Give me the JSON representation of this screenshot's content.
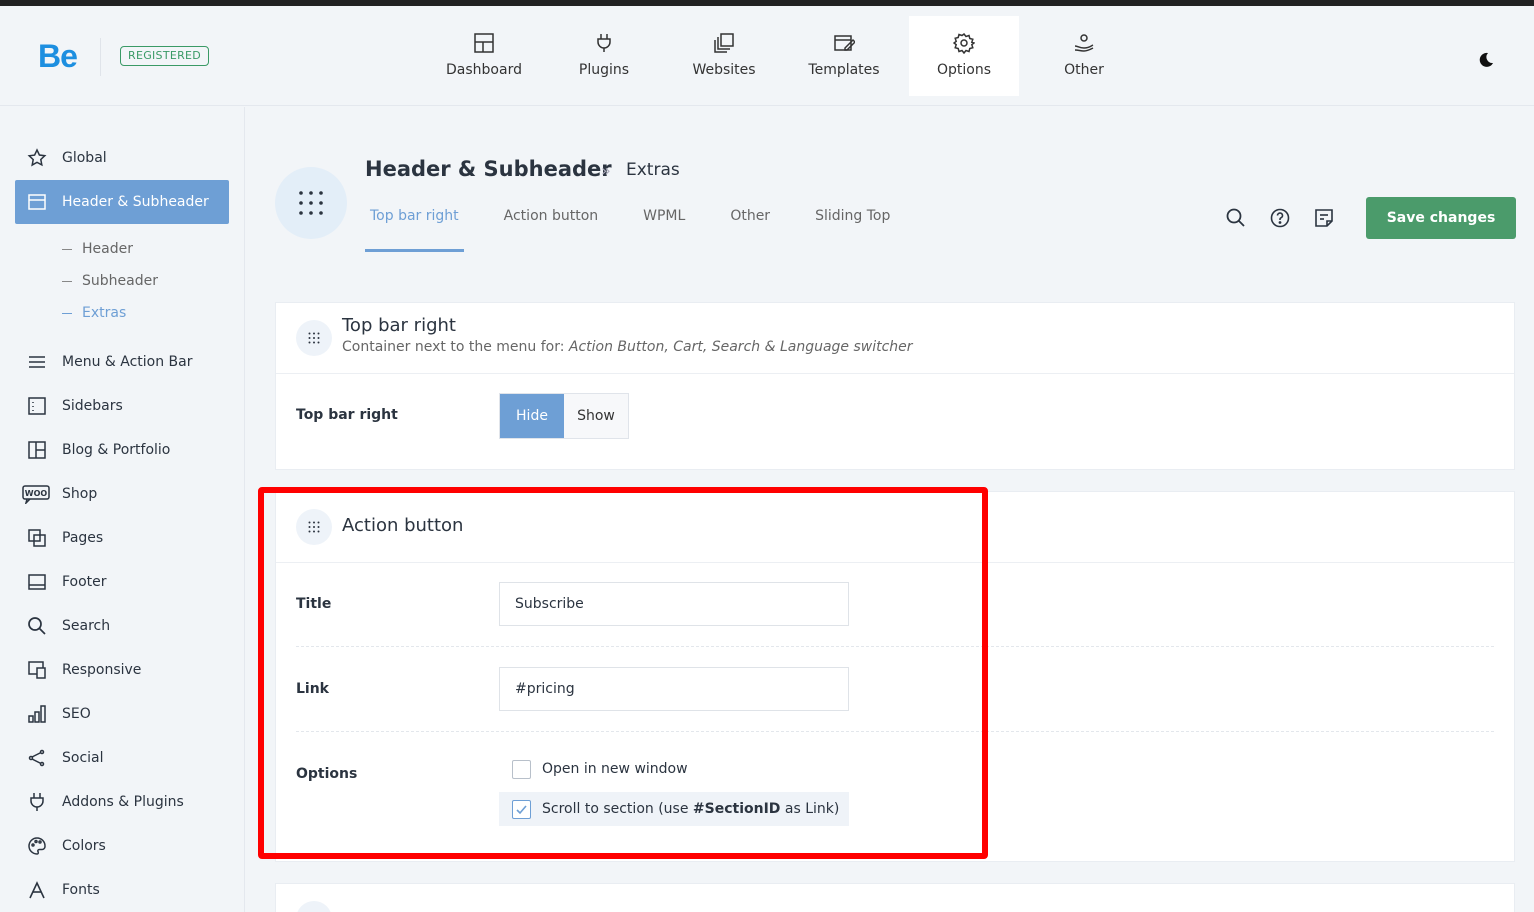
{
  "brand": {
    "logo": "Be",
    "badge": "REGISTERED"
  },
  "nav": [
    {
      "label": "Dashboard",
      "icon": "dashboard-icon"
    },
    {
      "label": "Plugins",
      "icon": "plug-icon"
    },
    {
      "label": "Websites",
      "icon": "websites-icon"
    },
    {
      "label": "Templates",
      "icon": "templates-icon"
    },
    {
      "label": "Options",
      "icon": "gear-icon",
      "active": true
    },
    {
      "label": "Other",
      "icon": "other-icon"
    }
  ],
  "sidebar": {
    "items": [
      {
        "label": "Global",
        "icon": "star-icon"
      },
      {
        "label": "Header & Subheader",
        "icon": "header-icon",
        "active": true
      },
      {
        "label": "Menu & Action Bar",
        "icon": "menu-icon"
      },
      {
        "label": "Sidebars",
        "icon": "sidebar-icon"
      },
      {
        "label": "Blog & Portfolio",
        "icon": "blog-icon"
      },
      {
        "label": "Shop",
        "icon": "woo-icon"
      },
      {
        "label": "Pages",
        "icon": "pages-icon"
      },
      {
        "label": "Footer",
        "icon": "footer-icon"
      },
      {
        "label": "Search",
        "icon": "search-icon"
      },
      {
        "label": "Responsive",
        "icon": "responsive-icon"
      },
      {
        "label": "SEO",
        "icon": "seo-icon"
      },
      {
        "label": "Social",
        "icon": "share-icon"
      },
      {
        "label": "Addons & Plugins",
        "icon": "plug-icon"
      },
      {
        "label": "Colors",
        "icon": "palette-icon"
      },
      {
        "label": "Fonts",
        "icon": "font-icon"
      }
    ],
    "subitems": [
      {
        "label": "Header"
      },
      {
        "label": "Subheader"
      },
      {
        "label": "Extras",
        "active": true
      }
    ]
  },
  "page": {
    "title": "Header & Subheader",
    "separator": "»",
    "subtitle": "Extras",
    "tabs": [
      "Top bar right",
      "Action button",
      "WPML",
      "Other",
      "Sliding Top"
    ],
    "active_tab": "Top bar right",
    "save_label": "Save changes"
  },
  "top_bar_card": {
    "title": "Top bar right",
    "desc_prefix": "Container next to the menu for: ",
    "desc_italic": "Action Button, Cart, Search & Language switcher",
    "field_label": "Top bar right",
    "options": [
      "Hide",
      "Show"
    ],
    "selected": "Hide"
  },
  "action_card": {
    "title": "Action button",
    "title_label": "Title",
    "title_value": "Subscribe",
    "link_label": "Link",
    "link_value": "#pricing",
    "options_label": "Options",
    "opt1": "Open in new window",
    "opt1_checked": false,
    "opt2_prefix": "Scroll to section (use ",
    "opt2_bold": "#SectionID",
    "opt2_suffix": " as Link)",
    "opt2_checked": true
  },
  "colors": {
    "accent": "#6e9fd5",
    "save": "#4b9b6b",
    "brand": "#1d8fe0",
    "highlight": "#ff0000"
  }
}
